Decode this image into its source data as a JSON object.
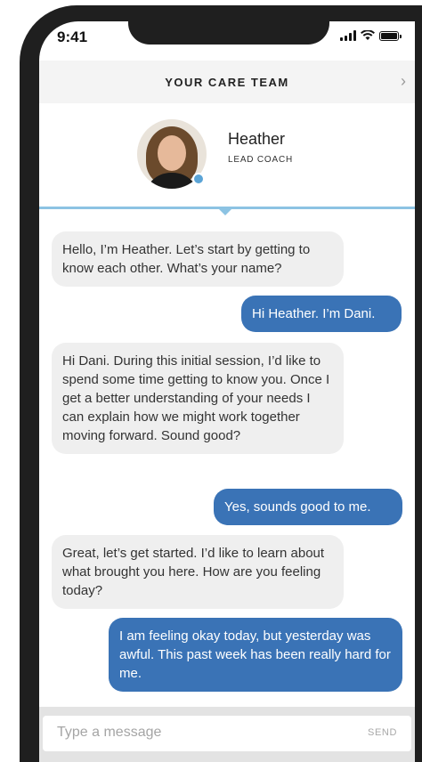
{
  "status_bar": {
    "time": "9:41"
  },
  "header": {
    "title": "YOUR CARE TEAM",
    "chevron": "›"
  },
  "coach": {
    "name": "Heather",
    "role": "LEAD COACH"
  },
  "messages": [
    {
      "from": "coach",
      "text": "Hello, I’m Heather. Let’s start by getting to know each other. What’s your name?"
    },
    {
      "from": "user",
      "text": "Hi Heather. I’m Dani."
    },
    {
      "from": "coach",
      "text": "Hi Dani. During this initial session, I’d like to spend some time getting to know you. Once I get a better understanding of your needs I can explain how we might work together moving forward. Sound good?"
    },
    {
      "from": "user",
      "text": "Yes, sounds good to me."
    },
    {
      "from": "coach",
      "text": "Great, let’s get started. I’d like to learn about what brought you here. How are you feeling today?"
    },
    {
      "from": "user",
      "text": "I am feeling okay today, but yesterday was awful. This past week has been really hard for me."
    }
  ],
  "composer": {
    "placeholder": "Type a message",
    "value": "",
    "send_label": "SEND"
  },
  "colors": {
    "user_bubble": "#3a73b6",
    "coach_bubble": "#efefef",
    "accent": "#8cc3e3"
  }
}
